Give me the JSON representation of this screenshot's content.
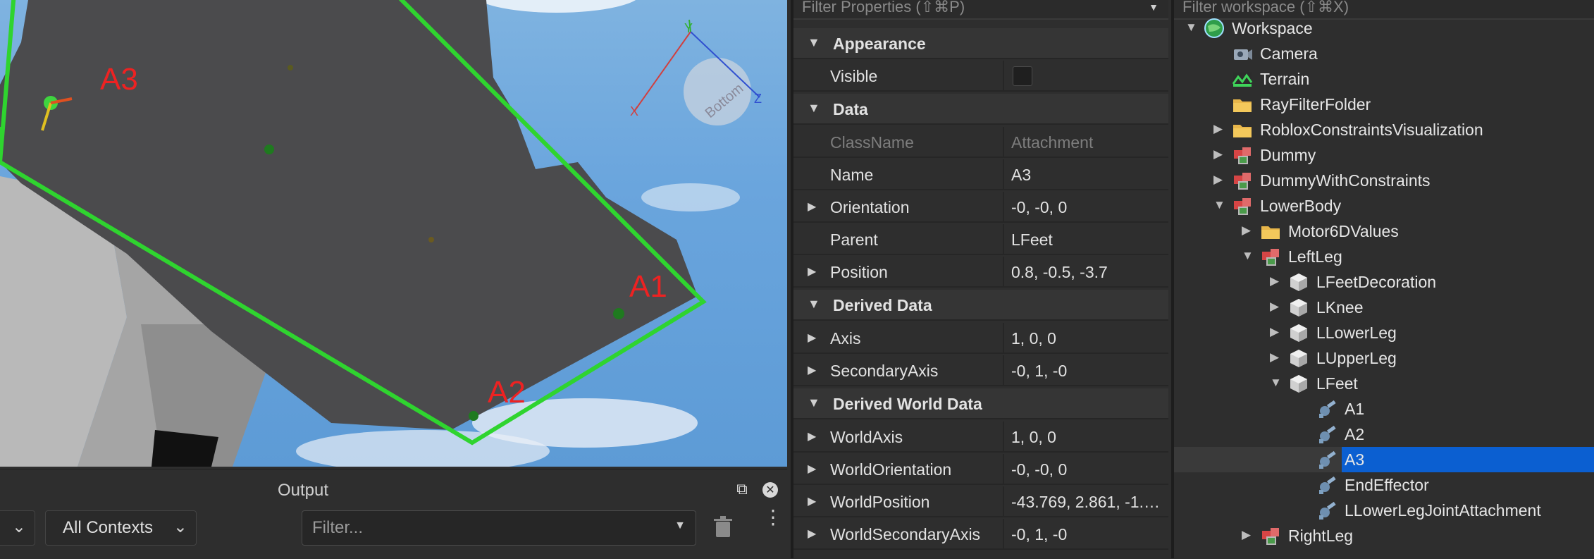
{
  "viewport": {
    "labels": [
      "A3",
      "A1",
      "A2"
    ],
    "gizmo": {
      "y": "Y",
      "x": "X",
      "z": "Z",
      "face": "Bottom"
    }
  },
  "output": {
    "title": "Output",
    "level_dropdown": "",
    "context_dropdown": "All Contexts",
    "filter_placeholder": "Filter..."
  },
  "properties": {
    "filter_placeholder": "Filter Properties (⇧⌘P)",
    "sections": {
      "appearance": "Appearance",
      "data": "Data",
      "derived": "Derived Data",
      "derived_world": "Derived World Data"
    },
    "rows": {
      "visible": {
        "name": "Visible",
        "checked": false
      },
      "classname": {
        "name": "ClassName",
        "value": "Attachment"
      },
      "name": {
        "name": "Name",
        "value": "A3"
      },
      "orientation": {
        "name": "Orientation",
        "value": "-0, -0, 0"
      },
      "parent": {
        "name": "Parent",
        "value": "LFeet"
      },
      "position": {
        "name": "Position",
        "value": "0.8, -0.5, -3.7"
      },
      "axis": {
        "name": "Axis",
        "value": "1, 0, 0"
      },
      "secondary_axis": {
        "name": "SecondaryAxis",
        "value": "-0, 1, -0"
      },
      "world_axis": {
        "name": "WorldAxis",
        "value": "1, 0, 0"
      },
      "world_orientation": {
        "name": "WorldOrientation",
        "value": "-0, -0, 0"
      },
      "world_position": {
        "name": "WorldPosition",
        "value": "-43.769, 2.861, -1.8…"
      },
      "world_secondary_axis": {
        "name": "WorldSecondaryAxis",
        "value": "-0, 1, -0"
      }
    }
  },
  "explorer": {
    "filter_placeholder": "Filter workspace (⇧⌘X)",
    "items": [
      {
        "label": "Workspace",
        "icon": "globe-icon"
      },
      {
        "label": "Camera",
        "icon": "camera-icon"
      },
      {
        "label": "Terrain",
        "icon": "terrain-icon"
      },
      {
        "label": "RayFilterFolder",
        "icon": "folder-icon"
      },
      {
        "label": "RobloxConstraintsVisualization",
        "icon": "folder-icon"
      },
      {
        "label": "Dummy",
        "icon": "model-icon"
      },
      {
        "label": "DummyWithConstraints",
        "icon": "model-icon"
      },
      {
        "label": "LowerBody",
        "icon": "model-icon"
      },
      {
        "label": "Motor6DValues",
        "icon": "folder-icon"
      },
      {
        "label": "LeftLeg",
        "icon": "model-icon"
      },
      {
        "label": "LFeetDecoration",
        "icon": "part-icon"
      },
      {
        "label": "LKnee",
        "icon": "part-icon"
      },
      {
        "label": "LLowerLeg",
        "icon": "part-icon"
      },
      {
        "label": "LUpperLeg",
        "icon": "part-icon"
      },
      {
        "label": "LFeet",
        "icon": "part-icon"
      },
      {
        "label": "A1",
        "icon": "attachment-icon"
      },
      {
        "label": "A2",
        "icon": "attachment-icon"
      },
      {
        "label": "A3",
        "icon": "attachment-icon",
        "selected": true
      },
      {
        "label": "EndEffector",
        "icon": "attachment-icon"
      },
      {
        "label": "LLowerLegJointAttachment",
        "icon": "attachment-icon"
      },
      {
        "label": "RightLeg",
        "icon": "model-icon"
      }
    ]
  }
}
